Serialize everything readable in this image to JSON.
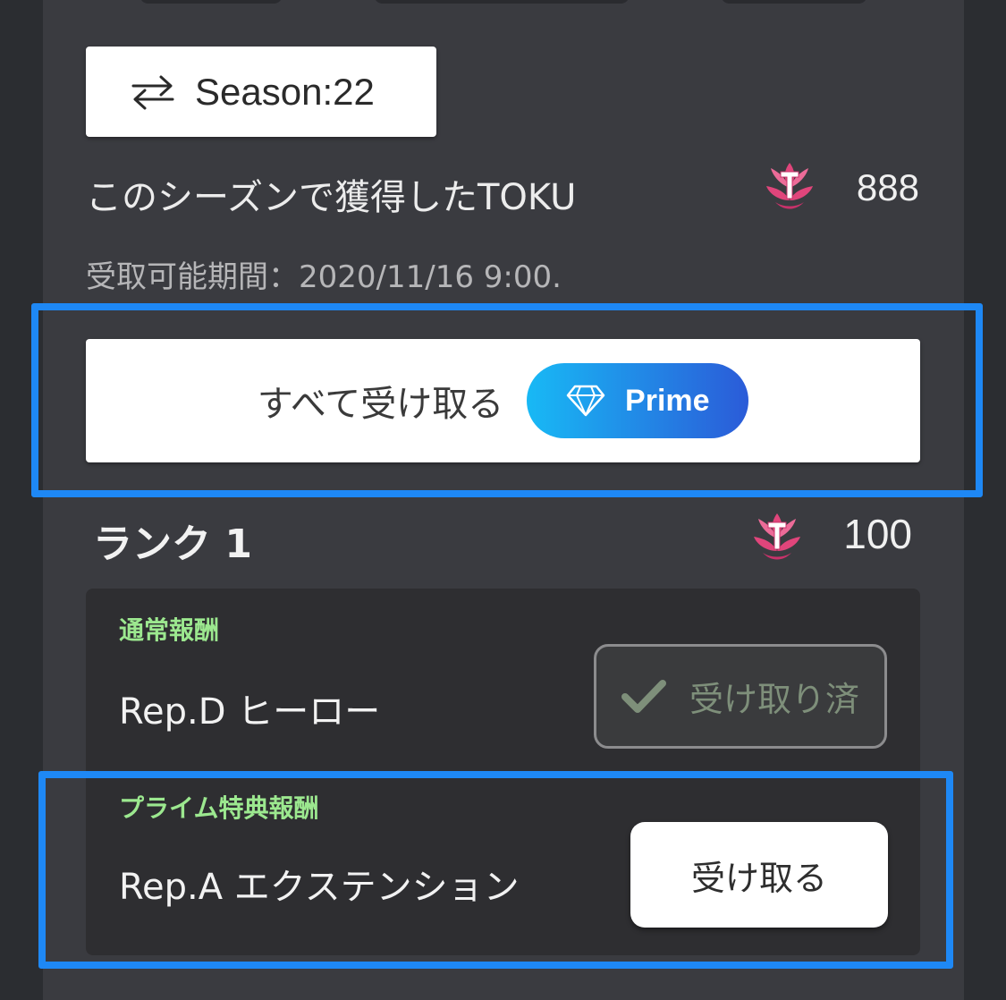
{
  "season": {
    "label": "Season:22"
  },
  "earned": {
    "label": "このシーズンで獲得したTOKU",
    "value": "888"
  },
  "period": {
    "text": "受取可能期間：2020/11/16 9:00."
  },
  "claim_all": {
    "label": "すべて受け取る",
    "badge_label": "Prime"
  },
  "rank": {
    "title": "ランク 1",
    "value": "100"
  },
  "rewards": {
    "normal": {
      "category": "通常報酬",
      "name": "Rep.D ヒーロー",
      "status_label": "受け取り済"
    },
    "prime": {
      "category": "プライム特典報酬",
      "name": "Rep.A エクステンション",
      "button_label": "受け取る"
    }
  },
  "colors": {
    "background": "#2b2d31",
    "panel": "#3a3b40",
    "card": "#2e2e31",
    "category_green": "#9ce88f",
    "highlight_blue": "#1e88f5",
    "prime_gradient_start": "#18b9f5",
    "prime_gradient_end": "#2b5bd8",
    "toku_pink": "#e0457b"
  },
  "icons": {
    "season_switch": "swap-arrows-icon",
    "toku": "toku-lotus-icon",
    "prime": "diamond-icon",
    "received": "check-icon"
  }
}
